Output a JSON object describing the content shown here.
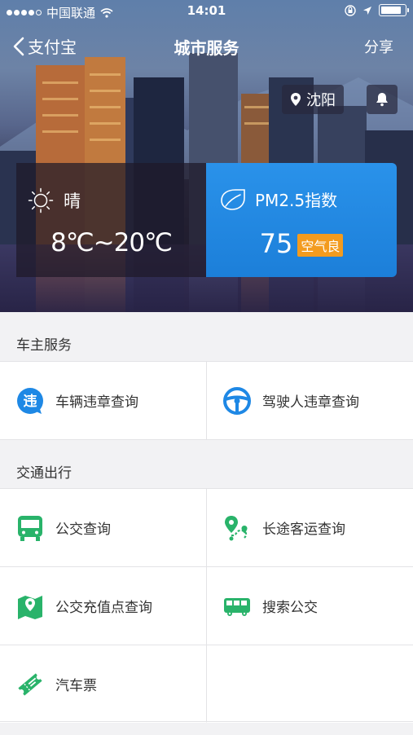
{
  "status_bar": {
    "carrier": "中国联通",
    "time": "14:01",
    "signal_icon": "signal-dots-icon",
    "wifi_icon": "wifi-icon",
    "lock_icon": "orientation-lock-icon",
    "location_icon": "location-arrow-icon",
    "battery_icon": "battery-icon",
    "battery_level": 0.85
  },
  "nav": {
    "back_label": "支付宝",
    "title": "城市服务",
    "share_label": "分享"
  },
  "city": {
    "name": "沈阳"
  },
  "weather": {
    "condition": "晴",
    "temperature": "8℃~20℃"
  },
  "pm25": {
    "label": "PM2.5指数",
    "value": "75",
    "quality": "空气良"
  },
  "sections": {
    "car_owner": {
      "title": "车主服务",
      "items": [
        {
          "label": "车辆违章查询",
          "icon": "violation-icon"
        },
        {
          "label": "驾驶人违章查询",
          "icon": "steering-wheel-icon"
        }
      ]
    },
    "transport": {
      "title": "交通出行",
      "items": [
        {
          "label": "公交查询",
          "icon": "bus-icon"
        },
        {
          "label": "长途客运查询",
          "icon": "route-map-icon"
        },
        {
          "label": "公交充值点查询",
          "icon": "map-pin-icon"
        },
        {
          "label": "搜索公交",
          "icon": "bus-side-icon"
        },
        {
          "label": "汽车票",
          "icon": "ticket-icon"
        }
      ]
    }
  },
  "colors": {
    "accent_blue": "#1e88e5",
    "accent_green": "#29b36a",
    "badge_orange": "#f39b1e"
  }
}
